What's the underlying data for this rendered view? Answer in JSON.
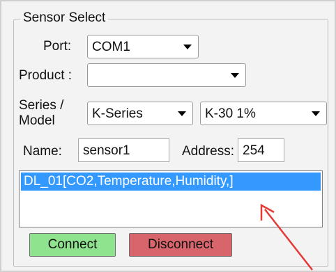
{
  "sensor_select": {
    "title": "Sensor Select",
    "port_label": "Port:",
    "port_value": "COM1",
    "product_label": "Product :",
    "product_value": "",
    "series_label_line1": "Series /",
    "series_label_line2": "Model",
    "series_value": "K-Series",
    "model_value": "K-30 1%",
    "name_label": "Name:",
    "name_value": "sensor1",
    "address_label": "Address:",
    "address_value": "254",
    "list_items": [
      "DL_01[CO2,Temperature,Humidity,]"
    ],
    "connect_label": "Connect",
    "disconnect_label": "Disconnect"
  },
  "colors": {
    "connect_bg": "#8fe38f",
    "disconnect_bg": "#d8656b",
    "selection": "#3399ff",
    "annotation_arrow": "#e53935"
  }
}
